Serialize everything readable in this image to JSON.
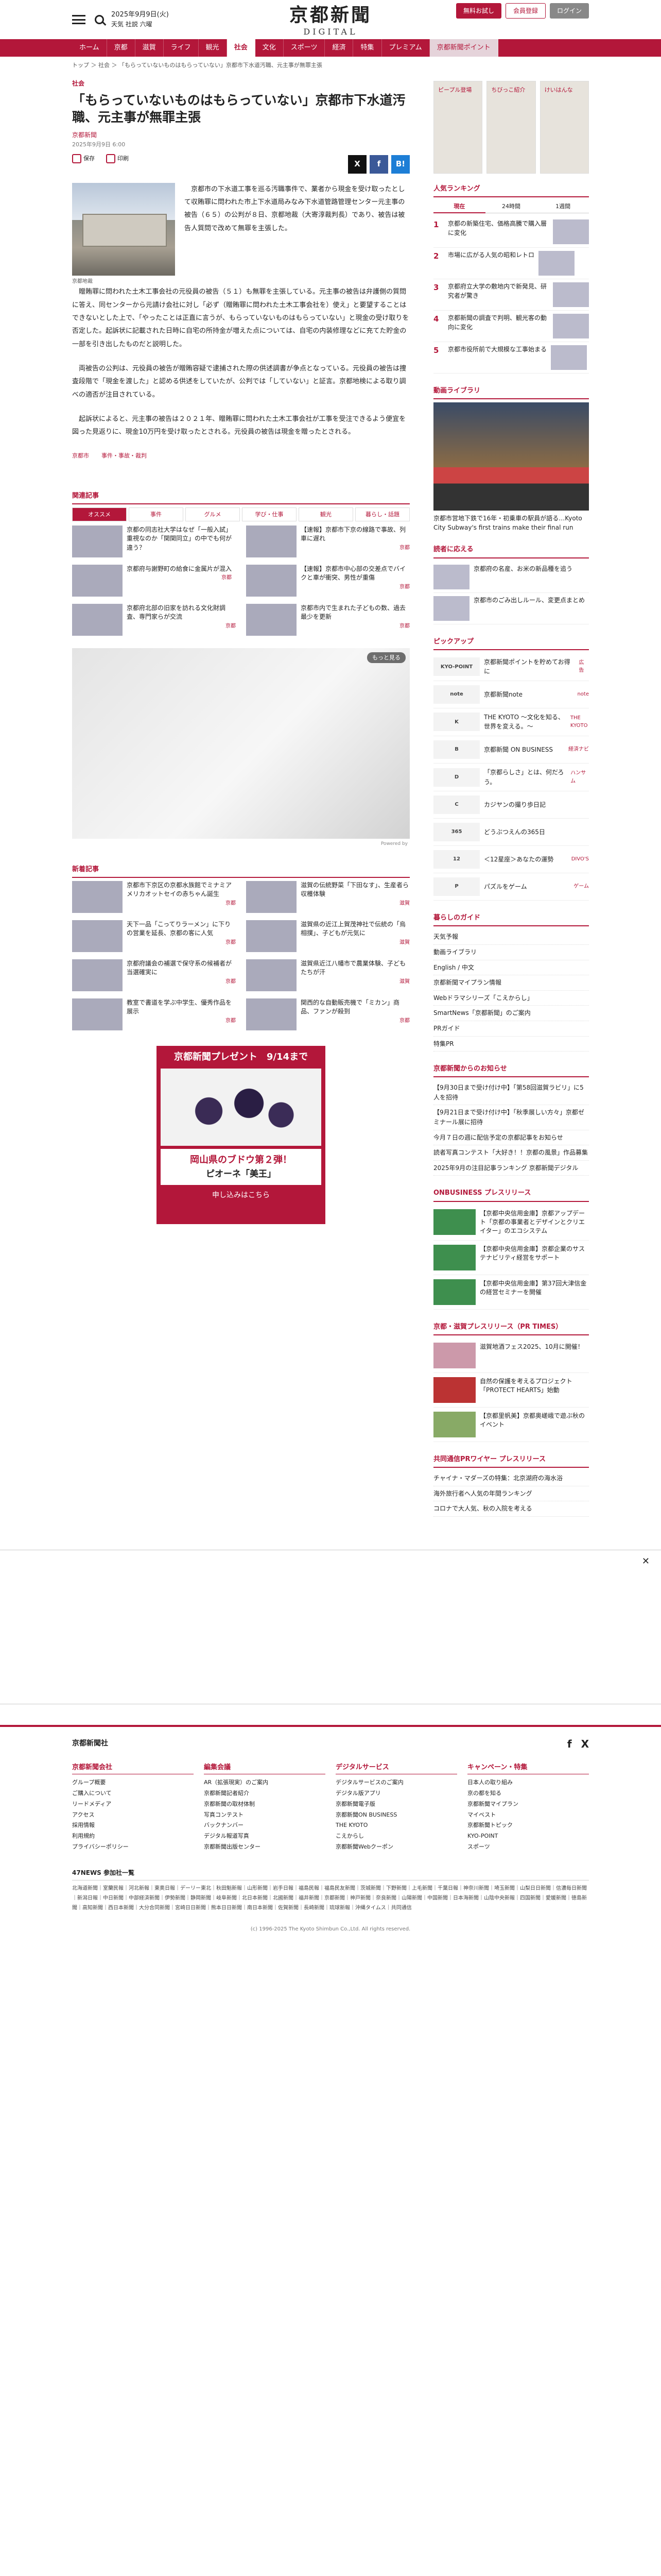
{
  "header": {
    "date": "2025年9月9日(火)",
    "weather": "天気  社説  六曜",
    "logo_jp": "京都新聞",
    "logo_en": "DIGITAL",
    "top_links": [
      "京都新聞",
      "会員登録",
      "プレミアム"
    ],
    "btn_login": "ログイン",
    "btn_register": "会員登録",
    "btn_trial": "無料お試し"
  },
  "nav": [
    "ホーム",
    "京都",
    "滋賀",
    "ライフ",
    "観光",
    "社会",
    "文化",
    "スポーツ",
    "経済",
    "特集",
    "プレミアム",
    "京都新聞ポイント"
  ],
  "breadcrumb": "トップ ＞ 社会 ＞ 「もらっていないものはもらっていない」京都市下水道汚職、元主事が無罪主張",
  "article": {
    "category": "社会",
    "title": "「もらっていないものはもらっていない」京都市下水道汚職、元主事が無罪主張",
    "author": "京都新聞",
    "published": "2025年9月9日 6:00",
    "tool_save": "保存",
    "tool_print": "印刷",
    "share": [
      "X",
      "f",
      "B!"
    ],
    "photo_caption": "京都地裁",
    "paragraphs": [
      "京都市の下水道工事を巡る汚職事件で、業者から現金を受け取ったとして収賄罪に問われた市上下水道局みなみ下水道管路管理センター元主事の被告（６５）の公判が８日、京都地裁（大寄淳裁判長）であり、被告は被告人質問で改めて無罪を主張した。",
      "贈賄罪に問われた土木工事会社の元役員の被告（５１）も無罪を主張している。元主事の被告は弁護側の質問に答え、同センターから元請け会社に対し「必ず（贈賄罪に問われた土木工事会社を）使え」と要望することはできないとした上で、「やったことは正直に言うが、もらっていないものはもらっていない」と現金の受け取りを否定した。起訴状に記載された日時に自宅の所持金が増えた点については、自宅の内装修理などに充てた貯金の一部を引き出したものだと説明した。",
      "両被告の公判は、元役員の被告が贈賄容疑で逮捕された際の供述調書が争点となっている。元役員の被告は捜査段階で「現金を渡した」と認める供述をしていたが、公判では「していない」と証言。京都地検による取り調べの適否が注目されている。",
      "起訴状によると、元主事の被告は２０２１年、贈賄罪に問われた土木工事会社が工事を受注できるよう便宜を図った見返りに、現金10万円を受け取ったとされる。元役員の被告は現金を贈ったとされる。"
    ],
    "tags": [
      "京都市",
      "事件・事故・裁判"
    ]
  },
  "related": {
    "heading": "関連記事",
    "tabs": [
      "オススメ",
      "事件",
      "グルメ",
      "学び・仕事",
      "観光",
      "暮らし・話題"
    ],
    "items": [
      {
        "text": "京都の同志社大学はなぜ「一般入試」重視なのか「関関同立」の中でも何が違う？",
        "loc": ""
      },
      {
        "text": "【速報】京都市下京の線路で事故、列車に遅れ",
        "loc": "京都"
      },
      {
        "text": "京都府与謝野町の給食に金属片が混入",
        "loc": "京都"
      },
      {
        "text": "【速報】京都市中心部の交差点でバイクと車が衝突、男性が重傷",
        "loc": "京都"
      },
      {
        "text": "京都府北部の旧家を訪れる文化財調査、専門家らが交流",
        "loc": "京都"
      },
      {
        "text": "京都市内で生まれた子どもの数、過去最少を更新",
        "loc": "京都"
      }
    ]
  },
  "ad": {
    "more": "もっと見る",
    "powered": "Powered by"
  },
  "latest": {
    "heading": "新着記事",
    "items": [
      {
        "text": "京都市下京区の京都水族館でミナミアメリカオットセイの赤ちゃん誕生",
        "loc": "京都"
      },
      {
        "text": "滋賀の伝統野菜「下田なす」、生産者ら収穫体験",
        "loc": "滋賀"
      },
      {
        "text": "天下一品「こってりラーメン」に下りの営業を延長、京都の客に人気",
        "loc": "京都"
      },
      {
        "text": "滋賀県の近江上賀茂神社で伝統の「烏相撲」、子どもが元気に",
        "loc": "滋賀"
      },
      {
        "text": "京都府議会の補選で保守系の候補者が当選確実に",
        "loc": "京都"
      },
      {
        "text": "滋賀県近江八幡市で農業体験、子どもたちが汗",
        "loc": "滋賀"
      },
      {
        "text": "教室で書道を学ぶ中学生、優秀作品を展示",
        "loc": "京都"
      },
      {
        "text": "関西的な自動販売機で「ミカン」商品、ファンが殺到",
        "loc": "京都"
      }
    ]
  },
  "promo": {
    "title": "京都新聞プレゼント",
    "deadline": "9/14まで",
    "line1": "岡山県のブドウ第２弾！",
    "line2": "ピオーネ「美王」",
    "apply": "申し込みはこちら"
  },
  "side": {
    "banners": [
      "ピープル登場",
      "ちびっこ紹介",
      "けいはんな"
    ],
    "ranking_heading": "人気ランキング",
    "ranking_tabs": [
      "現在",
      "24時間",
      "1週間"
    ],
    "ranking": [
      "京都の新築住宅、価格高騰で購入層に変化",
      "市場に広がる人気の昭和レトロ",
      "京都府立大学の敷地内で新発見、研究者が驚き",
      "京都新聞の調査で判明、観光客の動向に変化",
      "京都市役所前で大規模な工事始まる"
    ],
    "video_heading": "動画ライブラリ",
    "video_caption": "京都市営地下鉄で16年・初乗車の駅員が語る…Kyoto City Subway's first trains make their final run",
    "notice_heading": "読者に応える",
    "notices": [
      "京都府の名産、お米の新品種を追う",
      "京都市のごみ出しルール、変更点まとめ"
    ],
    "pickup_heading": "ピックアップ",
    "pickups": [
      {
        "logo": "KYO-POINT",
        "text": "京都新聞ポイントを貯めてお得に",
        "tag": "広告"
      },
      {
        "logo": "note",
        "text": "京都新聞note",
        "tag": "note"
      },
      {
        "logo": "K",
        "text": "THE KYOTO ～文化を知る、世界を変える。～",
        "tag": "THE KYOTO"
      },
      {
        "logo": "B",
        "text": "京都新聞 ON BUSINESS",
        "tag": "経済ナビ"
      },
      {
        "logo": "D",
        "text": "「京都らしさ」とは、何だろう。",
        "tag": "ハンサム"
      },
      {
        "logo": "C",
        "text": "カジヤンの撮り歩日記",
        "tag": ""
      },
      {
        "logo": "365",
        "text": "どうぶつえんの365日",
        "tag": ""
      },
      {
        "logo": "12",
        "text": "＜12星座＞あなたの運勢",
        "tag": "DIVO'S"
      },
      {
        "logo": "P",
        "text": "パズルをゲーム",
        "tag": "ゲーム"
      }
    ],
    "guide_heading": "暮らしのガイド",
    "guide": [
      "天気予報",
      "動画ライブラリ",
      "English / 中文",
      "京都新聞マイプラン情報",
      "Webドラマシリーズ「こえからし」",
      "SmartNews「京都新聞」のご案内",
      "PRガイド",
      "特集PR"
    ],
    "notice2_heading": "京都新聞からのお知らせ",
    "notice2": [
      "【9月30日まで受け付け中】「第58回滋賀ラビリ」に5人を招待",
      "【9月21日まで受け付け中】「秋季展しい方々」京都ゼミナール展に招待",
      "今月７日の週に配信予定の京都記事をお知らせ",
      "読者写真コンテスト「大好き！！京都の風景」作品募集",
      "2025年9月の注目記事ランキング 京都新聞デジタル"
    ],
    "biz_heading": "ONBUSINESS プレスリリース",
    "biz": [
      "【京都中央信用金庫】京都アップデート「京都の事業者とデザインとクリエイター」のエコシステム",
      "【京都中央信用金庫】京都企業のサステナビリティ経営をサポート",
      "【京都中央信用金庫】第37回大津信金の経営セミナーを開催"
    ],
    "pr_heading": "京都・滋賀プレスリリース（PR TIMES）",
    "pr": [
      "滋賀地酒フェス2025、10月に開催！",
      "自然の保護を考えるプロジェクト「PROTECT HEARTS」始動",
      "【京都里帆美】京都奥嵯峨で遊ぶ秋のイベント"
    ],
    "coop_heading": "共同通信PRワイヤー プレスリリース",
    "coop": [
      "チャイナ・マダーズの特集：北京湖府の海水浴",
      "海外旅行者へ人気の年間ランキング",
      "コロナで大人気、秋の入院を考える"
    ]
  },
  "footer": {
    "brand": "京都新聞社",
    "sns": [
      "f",
      "X"
    ],
    "cols": [
      {
        "h": "京都新聞会社",
        "items": [
          "グループ概要",
          "ご購入について",
          "リードメディア",
          "アクセス",
          "採用情報",
          "利用規約",
          "プライバシーポリシー"
        ]
      },
      {
        "h": "編集会議",
        "items": [
          "AR（拡張現実）のご案内",
          "京都新聞記者紹介",
          "京都新聞の取材体制",
          "写真コンテスト",
          "バックナンバー",
          "デジタル報道写真",
          "京都新聞出版センター"
        ]
      },
      {
        "h": "デジタルサービス",
        "items": [
          "デジタルサービスのご案内",
          "デジタル版アプリ",
          "京都新聞電子版",
          "京都新聞ON BUSINESS",
          "THE KYOTO",
          "こえからし",
          "京都新聞Webクーポン"
        ]
      },
      {
        "h": "キャンペーン・特集",
        "items": [
          "日本人の取り組み",
          "京の都を知る",
          "京都新聞マイプラン",
          "マイベスト",
          "京都新聞トピック",
          "KYO-POINT",
          "スポーツ"
        ]
      }
    ],
    "affil_heading": "47NEWS 参加社一覧",
    "affil": "北海道新聞｜室蘭民報｜河北新報｜東奥日報｜デーリー東北｜秋田魁新報｜山形新聞｜岩手日報｜福島民報｜福島民友新聞｜茨城新聞｜下野新聞｜上毛新聞｜千葉日報｜神奈川新聞｜埼玉新聞｜山梨日日新聞｜信濃毎日新聞｜新潟日報｜中日新聞｜中部経済新聞｜伊勢新聞｜静岡新聞｜岐阜新聞｜北日本新聞｜北國新聞｜福井新聞｜京都新聞｜神戸新聞｜奈良新聞｜山陽新聞｜中国新聞｜日本海新聞｜山陰中央新報｜四国新聞｜愛媛新聞｜徳島新聞｜高知新聞｜西日本新聞｜大分合同新聞｜宮崎日日新聞｜熊本日日新聞｜南日本新聞｜佐賀新聞｜長崎新聞｜琉球新報｜沖縄タイムス｜共同通信",
    "copyright": "(c) 1996-2025 The Kyoto Shimbun Co.,Ltd. All rights reserved."
  }
}
